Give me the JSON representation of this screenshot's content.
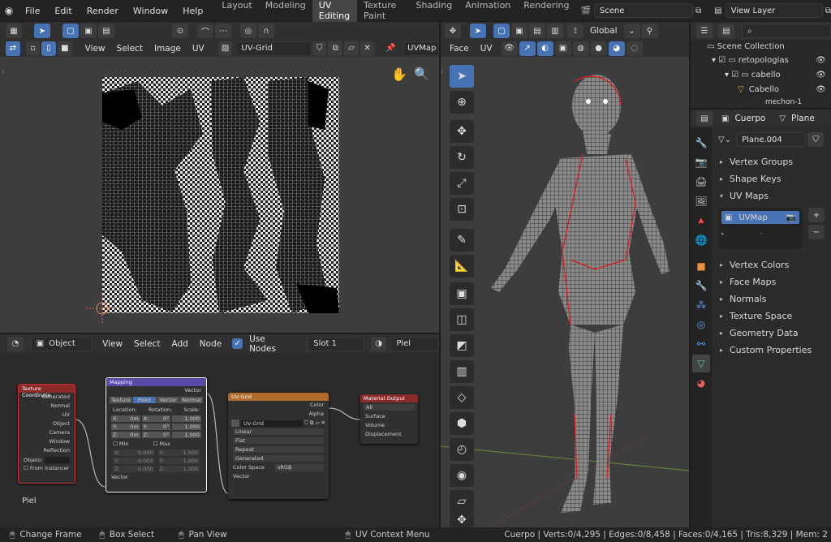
{
  "menu": {
    "file": "File",
    "edit": "Edit",
    "render": "Render",
    "window": "Window",
    "help": "Help"
  },
  "workspaces": [
    "Layout",
    "Modeling",
    "UV Editing",
    "Texture Paint",
    "Shading",
    "Animation",
    "Rendering"
  ],
  "scene": "Scene",
  "view_layer": "View Layer",
  "uv_editor": {
    "view": "View",
    "select": "Select",
    "image": "Image",
    "uv": "UV",
    "image_name": "UV-Grid",
    "uv_map": "UVMap"
  },
  "viewport": {
    "face": "Face",
    "uv": "UV",
    "orientation": "Global"
  },
  "node_editor": {
    "object": "Object",
    "view": "View",
    "select": "Select",
    "add": "Add",
    "node": "Node",
    "use_nodes": "Use Nodes",
    "slot": "Slot 1",
    "material": "Piel",
    "label": "Piel"
  },
  "nodes": {
    "texcoord": {
      "title": "Texture Coordinate",
      "outputs": [
        "Generated",
        "Normal",
        "UV",
        "Object",
        "Camera",
        "Window",
        "Reflection"
      ],
      "object": "Objeto:",
      "from_instancer": "From Instancer"
    },
    "mapping": {
      "title": "Mapping",
      "output": "Vector",
      "tabs": [
        "Texture",
        "Point",
        "Vector",
        "Normal"
      ],
      "location": "Location:",
      "rotation": "Rotation:",
      "scale": "Scale:",
      "rows": [
        [
          "X:",
          "0m",
          "X:",
          "0°",
          "1.000"
        ],
        [
          "Y:",
          "0m",
          "Y:",
          "0°",
          "1.000"
        ],
        [
          "Z:",
          "0m",
          "Z:",
          "0°",
          "1.000"
        ]
      ],
      "min": "Min",
      "max": "Max",
      "minmax": [
        [
          "X:",
          "0.000",
          "X:",
          "1.000"
        ],
        [
          "Y:",
          "0.000",
          "Y:",
          "1.000"
        ],
        [
          "Z:",
          "0.000",
          "Z:",
          "1.000"
        ]
      ],
      "input": "Vector"
    },
    "uvgrid": {
      "title": "UV-Grid",
      "outputs": [
        "Color",
        "Alpha"
      ],
      "image": "UV-Grid",
      "options": [
        "Linear",
        "Flat",
        "Repeat",
        "Generated"
      ],
      "color_space_label": "Color Space",
      "color_space": "sRGB",
      "input": "Vector"
    },
    "output": {
      "title": "Material Output",
      "target": "All",
      "inputs": [
        "Surface",
        "Volume",
        "Displacement"
      ]
    }
  },
  "outliner": {
    "title": "Scene Collection",
    "items": [
      "retopologias",
      "cabello",
      "Cabello",
      "mechon-1"
    ]
  },
  "properties": {
    "object": "Cuerpo",
    "data_tab": "Plane",
    "mesh": "Plane.004",
    "panels_top": [
      "Vertex Groups",
      "Shape Keys",
      "UV Maps"
    ],
    "uv_map": "UVMap",
    "panels_bottom": [
      "Vertex Colors",
      "Face Maps",
      "Normals",
      "Texture Space",
      "Geometry Data",
      "Custom Properties"
    ]
  },
  "status": {
    "change_frame": "Change Frame",
    "box_select": "Box Select",
    "pan_view": "Pan View",
    "uv_menu": "UV Context Menu",
    "stats": "Cuerpo | Verts:0/4,295 | Edges:0/8,458 | Faces:0/4,165 | Tris:8,329 | Mem: 2"
  }
}
